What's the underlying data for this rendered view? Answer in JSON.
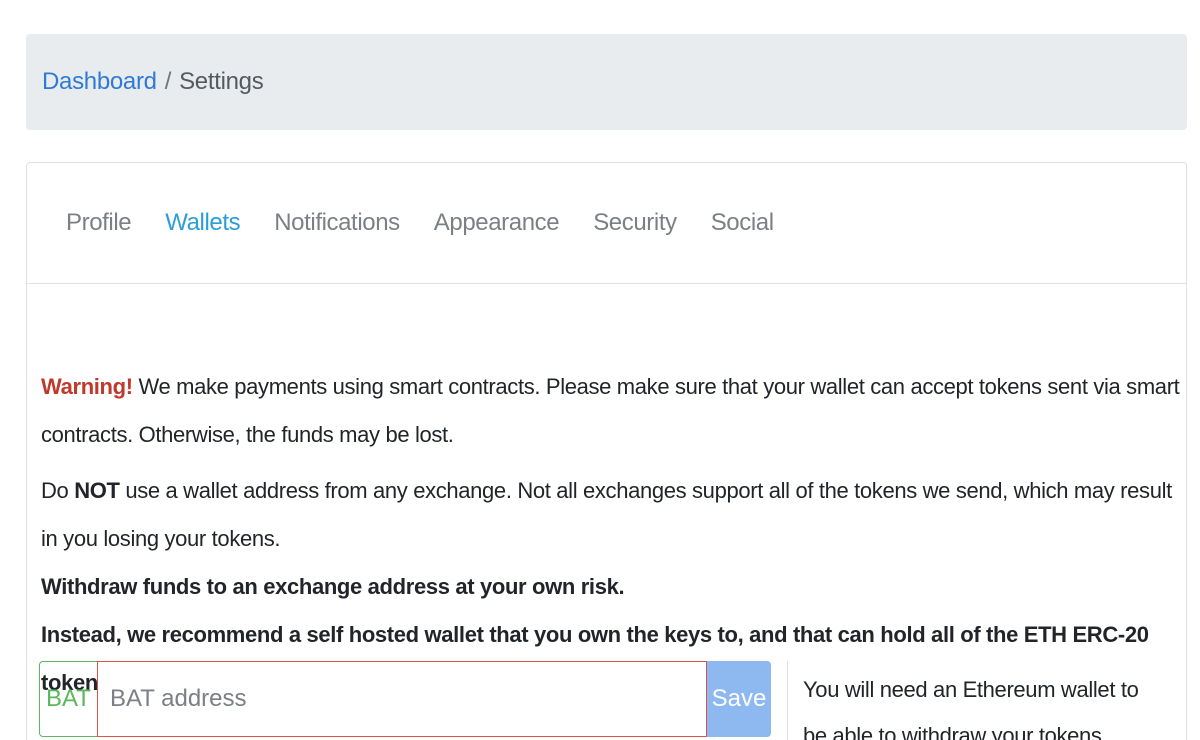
{
  "breadcrumb": {
    "home": "Dashboard",
    "separator": "/",
    "current": "Settings"
  },
  "tabs": [
    {
      "label": "Profile",
      "active": false
    },
    {
      "label": "Wallets",
      "active": true
    },
    {
      "label": "Notifications",
      "active": false
    },
    {
      "label": "Appearance",
      "active": false
    },
    {
      "label": "Security",
      "active": false
    },
    {
      "label": "Social",
      "active": false
    }
  ],
  "warning": {
    "label": "Warning!",
    "text": " We make payments using smart contracts. Please make sure that your wallet can accept tokens sent via smart contracts. Otherwise, the funds may be lost."
  },
  "exchange_notice": {
    "do": "Do ",
    "not": "NOT",
    "rest": " use a wallet address from any exchange. Not all exchanges support all of the tokens we send, which may result in you losing your tokens.",
    "risk": "Withdraw funds to an exchange address at your own risk.",
    "recommend": "Instead, we recommend a self hosted wallet that you own the keys to, and that can hold all of the ETH ERC-20 tokens."
  },
  "wallet_form": {
    "token": "BAT",
    "placeholder": "BAT address",
    "value": "",
    "save_label": "Save",
    "hint": "You will need an Ethereum wallet to be able to withdraw your tokens."
  },
  "colors": {
    "link": "#2f7ad6",
    "active_tab": "#2a9fd6",
    "warning": "#c0392b",
    "addon_border": "#5cb85c",
    "input_error_border": "#d9534f",
    "save_button": "#8db8f0"
  }
}
